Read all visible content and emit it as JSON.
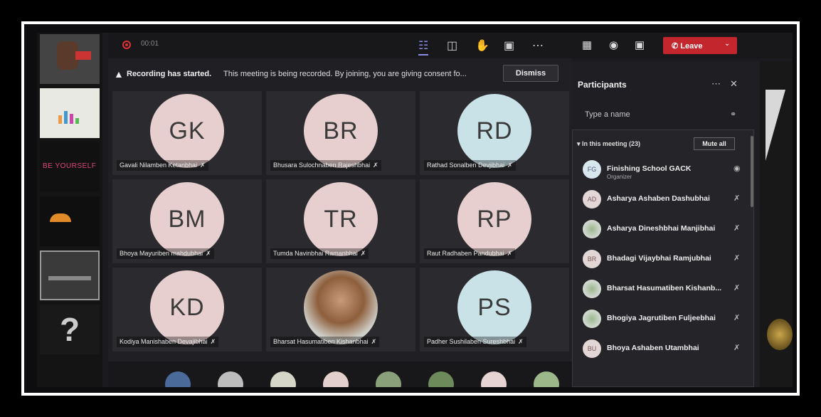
{
  "topbar": {
    "timer": "00:01",
    "icons": [
      "people-icon",
      "chat-icon",
      "raise-hand-icon",
      "share-icon",
      "more-icon"
    ]
  },
  "banner": {
    "title": "Recording has started.",
    "text": "This meeting is being recorded. By joining, you are giving consent fo...",
    "dismiss_label": "Dismiss"
  },
  "controls": {
    "leave_label": "Leave"
  },
  "slides": {
    "thumb3_text": "BE YOURSELF",
    "thumb6_glyph": "?"
  },
  "tiles": [
    {
      "initials": "GK",
      "name": "Gavali Nilamben Ketanbhai"
    },
    {
      "initials": "BR",
      "name": "Bhusara Sulochnaben Rajeshbhai"
    },
    {
      "initials": "RD",
      "name": "Rathad Sonalben Devjibhai"
    },
    {
      "initials": "BM",
      "name": "Bhoya Mayuriben mahdubhai"
    },
    {
      "initials": "TR",
      "name": "Tumda Navinbhai Ramanbhai"
    },
    {
      "initials": "RP",
      "name": "Raut Radhaben Pandubhai"
    },
    {
      "initials": "KD",
      "name": "Kodiya Manishaben Devajibhai"
    },
    {
      "initials": "",
      "name": "Bharsat Hasumatiben Kishanbhai"
    },
    {
      "initials": "PS",
      "name": "Padher Sushilaben Sureshbhai"
    }
  ],
  "panel": {
    "title": "Participants",
    "search_placeholder": "Type a name",
    "section_label": "In this meeting (23)",
    "mute_all_label": "Mute all",
    "participants": [
      {
        "initials": "FG",
        "name": "Finishing School GACK",
        "role": "Organizer"
      },
      {
        "initials": "AD",
        "name": "Asharya Ashaben Dashubhai",
        "role": ""
      },
      {
        "initials": "",
        "name": "Asharya Dineshbhai Manjibhai",
        "role": ""
      },
      {
        "initials": "BR",
        "name": "Bhadagi Vijaybhai Ramjubhai",
        "role": ""
      },
      {
        "initials": "",
        "name": "Bharsat Hasumatiben Kishanb...",
        "role": ""
      },
      {
        "initials": "",
        "name": "Bhogiya Jagrutiben Fuljeebhai",
        "role": ""
      },
      {
        "initials": "BU",
        "name": "Bhoya Ashaben Utambhai",
        "role": ""
      }
    ]
  }
}
